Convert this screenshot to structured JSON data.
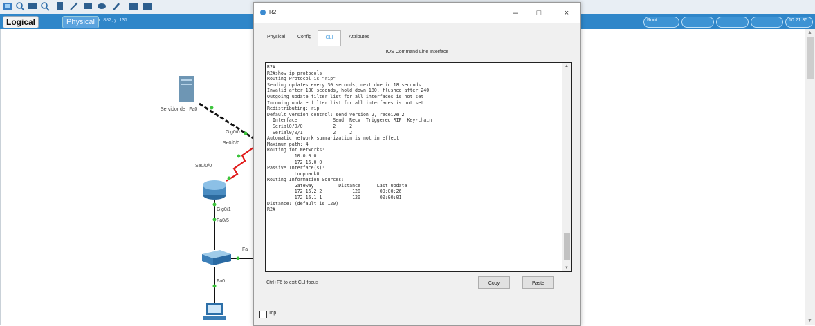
{
  "toolbar": {
    "icons": [
      "logical-view-icon",
      "zoom-in-icon",
      "zoom-out-icon",
      "zoom-reset-icon",
      "note-icon",
      "line-icon",
      "rectangle-icon",
      "ellipse-icon",
      "pencil-icon",
      "resize-icon",
      "palette-icon"
    ]
  },
  "workspace": {
    "tab_logical": "Logical",
    "tab_physical": "Physical",
    "physical_hint": "x: 882, y: 131",
    "right_bar": {
      "realtime": "Root",
      "time": "10:21:35"
    }
  },
  "devices": {
    "server_label": "Servidor de i Fa0",
    "router_links": {
      "gig00": "Gig0/0",
      "se000": "Se0/0/0",
      "se001": "Se0/0/0"
    },
    "switch_links": {
      "gig01": "Gig0/1",
      "fa05": "Fa0/5",
      "fa_right": "Fa",
      "fa0_pc": "Fa0"
    }
  },
  "window": {
    "title": "R2",
    "tabs": [
      "Physical",
      "Config",
      "CLI",
      "Attributes"
    ],
    "active_tab": "CLI",
    "cli_heading": "IOS Command Line Interface",
    "terminal_lines": [
      "R2#",
      "R2#show ip protocols",
      "Routing Protocol is \"rip\"",
      "Sending updates every 30 seconds, next due in 18 seconds",
      "Invalid after 180 seconds, hold down 180, flushed after 240",
      "Outgoing update filter list for all interfaces is not set",
      "Incoming update filter list for all interfaces is not set",
      "Redistributing: rip",
      "Default version control: send version 2, receive 2",
      "  Interface             Send  Recv  Triggered RIP  Key-chain",
      "  Serial0/0/0           2     2",
      "  Serial0/0/1           2     2",
      "Automatic network summarization is not in effect",
      "Maximum path: 4",
      "Routing for Networks:",
      "          10.0.0.0",
      "          172.16.0.0",
      "Passive Interface(s):",
      "          Loopback0",
      "Routing Information Sources:",
      "          Gateway         Distance      Last Update",
      "          172.16.2.2           120       00:00:26",
      "          172.16.1.1           120       00:00:01",
      "Distance: (default is 120)",
      "R2#"
    ],
    "hint": "Ctrl+F6 to exit CLI focus",
    "copy_label": "Copy",
    "paste_label": "Paste",
    "top_label": "Top"
  }
}
